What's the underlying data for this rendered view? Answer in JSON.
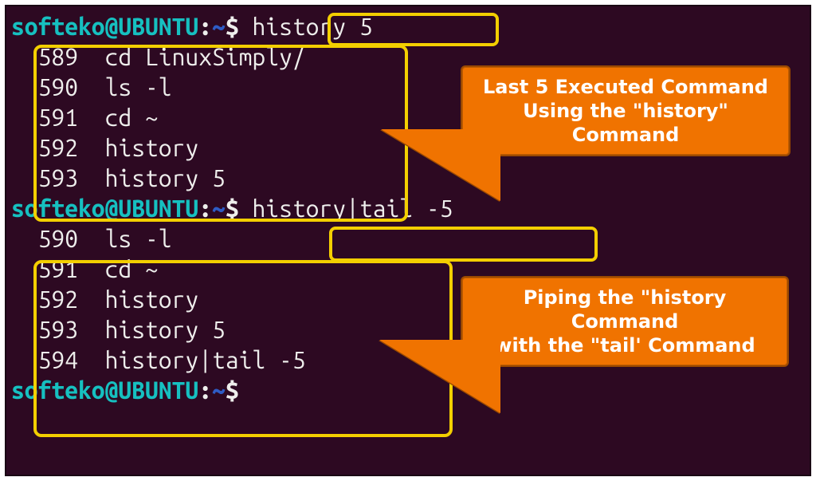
{
  "prompt": {
    "user": "softeko",
    "host": "UBUNTU",
    "sep_at": "@",
    "sep_colon": ":",
    "path": "~",
    "dollar": "$"
  },
  "block1": {
    "command": "history 5",
    "output": [
      {
        "num": "  589",
        "txt": "  cd LinuxSimply/"
      },
      {
        "num": "  590",
        "txt": "  ls -l"
      },
      {
        "num": "  591",
        "txt": "  cd ~"
      },
      {
        "num": "  592",
        "txt": "  history"
      },
      {
        "num": "  593",
        "txt": "  history 5"
      }
    ]
  },
  "block2": {
    "command": "history|tail -5",
    "output": [
      {
        "num": "  590",
        "txt": "  ls -l"
      },
      {
        "num": "  591",
        "txt": "  cd ~"
      },
      {
        "num": "  592",
        "txt": "  history"
      },
      {
        "num": "  593",
        "txt": "  history 5"
      },
      {
        "num": "  594",
        "txt": "  history|tail -5"
      }
    ]
  },
  "callouts": {
    "c1_l1": "Last 5 Executed Command",
    "c1_l2": "Using the \"history\" Command",
    "c2_l1": "Piping the \"history Command",
    "c2_l2": "with the \"tail' Command"
  }
}
